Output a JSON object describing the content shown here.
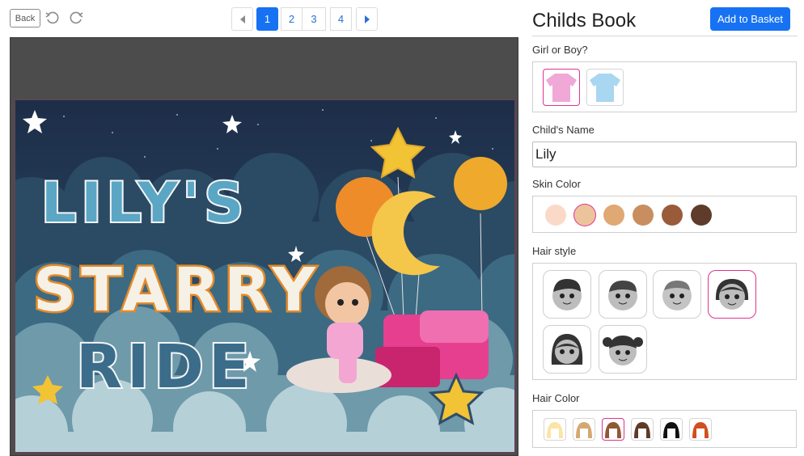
{
  "toolbar": {
    "back_label": "Back"
  },
  "pagination": {
    "pages": [
      "1",
      "2",
      "3",
      "4"
    ],
    "active_page": "1"
  },
  "cover": {
    "title_line1": "LILY'S",
    "title_line2": "STARRY",
    "title_line3": "RIDE"
  },
  "panel": {
    "title": "Childs Book",
    "add_to_basket_label": "Add to Basket",
    "gender": {
      "label": "Girl or Boy?",
      "options": [
        "girl-shirt",
        "boy-shirt"
      ],
      "selected": "girl-shirt",
      "colors": [
        "#f0a8d6",
        "#a9d6f0"
      ]
    },
    "child_name": {
      "label": "Child's Name",
      "value": "Lily"
    },
    "skin": {
      "label": "Skin Color",
      "colors": [
        "#fbd9c9",
        "#ecc49c",
        "#e0a872",
        "#c88e5f",
        "#9a5b3a",
        "#5e3b2b"
      ],
      "selected_index": 1
    },
    "hair_style": {
      "label": "Hair style",
      "selected_index": 3
    },
    "hair_color": {
      "label": "Hair Color",
      "colors": [
        "#fbe4a4",
        "#d4a870",
        "#8f5a33",
        "#5e3b25",
        "#111111",
        "#d34e1e"
      ],
      "selected_index": 2
    }
  },
  "accent_color": "#1672f3",
  "selection_color": "#e0338f"
}
